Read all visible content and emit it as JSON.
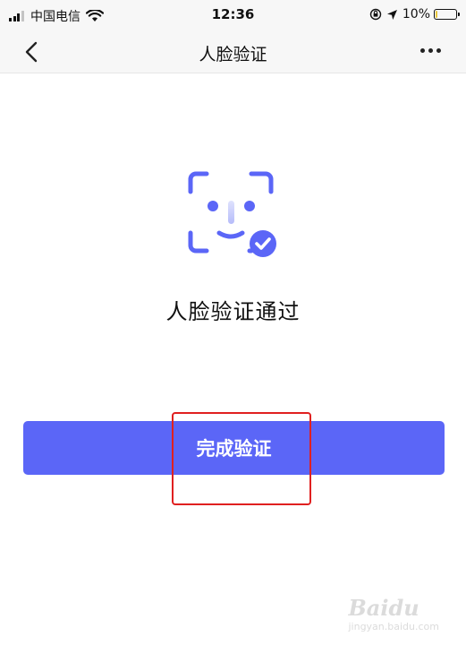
{
  "status_bar": {
    "carrier": "中国电信",
    "time": "12:36",
    "battery_percent": "10%",
    "battery_level": 0.1
  },
  "nav": {
    "title": "人脸验证",
    "back_icon": "chevron-left-icon",
    "more_icon": "more-dots-icon"
  },
  "main": {
    "face_icon": "face-verified-icon",
    "result_text": "人脸验证通过",
    "complete_button_label": "完成验证"
  },
  "watermark": {
    "logo": "Baidu",
    "sub": "jingyan.baidu.com"
  },
  "colors": {
    "accent": "#5b66f7",
    "highlight": "#e02020"
  }
}
